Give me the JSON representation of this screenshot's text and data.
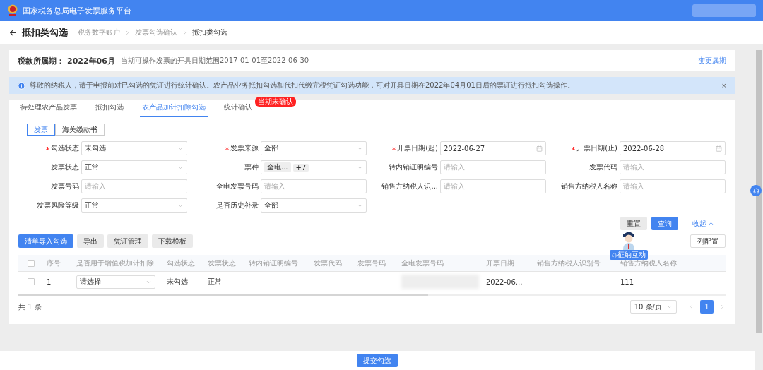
{
  "header": {
    "title": "国家税务总局电子发票服务平台"
  },
  "page": {
    "title": "抵扣类勾选",
    "breadcrumb": [
      "税务数字账户",
      "发票勾选确认",
      "抵扣类勾选"
    ]
  },
  "period": {
    "label": "税款所属期：",
    "value": "2022年06月",
    "note": "当期可操作发票的开具日期范围2017-01-01至2022-06-30",
    "action": "变更属期"
  },
  "notice": {
    "text": "尊敬的纳税人，请于申报前对已勾选的凭证进行统计确认。农产品业务抵扣勾选和代扣代缴完税凭证勾选功能，可对开具日期在2022年04月01日后的票证进行抵扣勾选操作。",
    "close": "×"
  },
  "tabs": [
    {
      "label": "待处理农产品发票",
      "selected": false
    },
    {
      "label": "抵扣勾选",
      "selected": false
    },
    {
      "label": "农产品加计扣除勾选",
      "selected": true
    },
    {
      "label": "统计确认",
      "selected": false,
      "badge": "当期未确认"
    }
  ],
  "subtabs": [
    {
      "label": "发票",
      "selected": true
    },
    {
      "label": "海关缴款书",
      "selected": false
    }
  ],
  "filters": [
    {
      "label": "勾选状态",
      "kind": "select",
      "required": true,
      "value": "未勾选"
    },
    {
      "label": "发票来源",
      "kind": "select",
      "required": true,
      "value": "全部"
    },
    {
      "label": "开票日期(起)",
      "kind": "date",
      "required": true,
      "value": "2022-06-27"
    },
    {
      "label": "开票日期(止)",
      "kind": "date",
      "required": true,
      "value": "2022-06-28"
    },
    {
      "label": "发票状态",
      "kind": "select",
      "required": false,
      "value": "正常"
    },
    {
      "label": "票种",
      "kind": "tags",
      "required": false,
      "tags": [
        "全电...",
        "+7"
      ]
    },
    {
      "label": "转内销证明编号",
      "kind": "input",
      "required": false,
      "placeholder": "请输入"
    },
    {
      "label": "发票代码",
      "kind": "input",
      "required": false,
      "placeholder": "请输入"
    },
    {
      "label": "发票号码",
      "kind": "input",
      "required": false,
      "placeholder": "请输入"
    },
    {
      "label": "全电发票号码",
      "kind": "input",
      "required": false,
      "placeholder": "请输入"
    },
    {
      "label": "销售方纳税人识...",
      "kind": "input",
      "required": false,
      "placeholder": "请输入"
    },
    {
      "label": "销售方纳税人名称",
      "kind": "input",
      "required": false,
      "placeholder": "请输入"
    },
    {
      "label": "发票风险等级",
      "kind": "select",
      "required": false,
      "value": "正常"
    },
    {
      "label": "是否历史补录",
      "kind": "select",
      "required": false,
      "value": "全部"
    }
  ],
  "filter_actions": {
    "reset": "重置",
    "search": "查询",
    "collapse": "收起"
  },
  "toolbar": [
    {
      "label": "清单导入勾选",
      "primary": true
    },
    {
      "label": "导出",
      "primary": false
    },
    {
      "label": "凭证管理",
      "primary": false
    },
    {
      "label": "下载模板",
      "primary": false
    }
  ],
  "column_config": "列配置",
  "assistant_badge": "征纳互动",
  "table": {
    "select_all_checked": false,
    "columns": [
      "序号",
      "是否用于增值税加计扣除",
      "勾选状态",
      "发票状态",
      "转内销证明编号",
      "发票代码",
      "发票号码",
      "全电发票号码",
      "开票日期",
      "销售方纳税人识别号",
      "销售方纳税人名称"
    ],
    "rows": [
      {
        "checked": false,
        "cells": [
          {
            "kind": "text",
            "text": "1"
          },
          {
            "kind": "select",
            "text": "请选择"
          },
          {
            "kind": "text",
            "text": "未勾选"
          },
          {
            "kind": "text",
            "text": "正常"
          },
          {
            "kind": "text",
            "text": ""
          },
          {
            "kind": "text",
            "text": ""
          },
          {
            "kind": "text",
            "text": ""
          },
          {
            "kind": "blurred"
          },
          {
            "kind": "text",
            "text": "2022-06..."
          },
          {
            "kind": "text",
            "text": ""
          },
          {
            "kind": "text",
            "text": "111"
          }
        ]
      }
    ]
  },
  "pagination": {
    "total": "共 1 条",
    "page_size": "10 条/页",
    "pages": [
      {
        "label": "1",
        "selected": true
      }
    ]
  },
  "footer": {
    "submit": "提交勾选"
  }
}
